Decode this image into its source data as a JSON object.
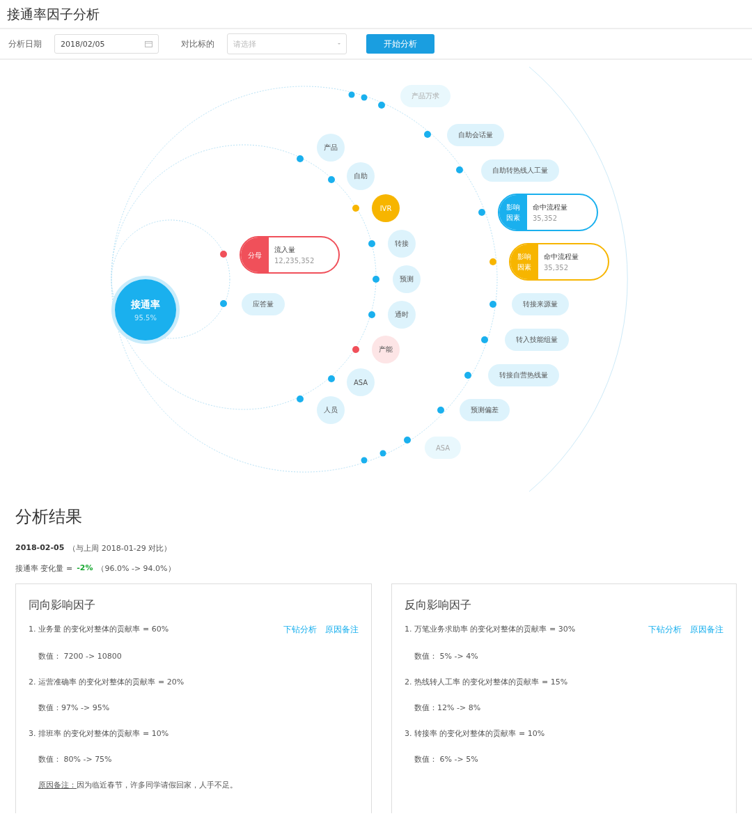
{
  "page": {
    "title": "接通率因子分析"
  },
  "toolbar": {
    "date_label": "分析日期",
    "date_value": "2018/02/05",
    "target_label": "对比标的",
    "target_placeholder": "请选择",
    "start_button": "开始分析"
  },
  "diagram": {
    "center": {
      "label": "接通率",
      "value": "95.5%"
    },
    "rings": [
      [
        {
          "kind": "factor",
          "color": "#f0505a",
          "tag": "分母",
          "label": "流入量",
          "value": "12,235,352"
        },
        {
          "kind": "label",
          "color": "#1ab0ee",
          "dimmed": false,
          "label": "应答量"
        }
      ],
      [
        {
          "kind": "bubble",
          "color": "#1ab0ee",
          "filled": false,
          "label": "产品"
        },
        {
          "kind": "bubble",
          "color": "#1ab0ee",
          "filled": false,
          "label": "自助"
        },
        {
          "kind": "bubble",
          "color": "#f7b500",
          "filled": true,
          "label": "IVR"
        },
        {
          "kind": "bubble",
          "color": "#1ab0ee",
          "filled": false,
          "label": "转接"
        },
        {
          "kind": "bubble",
          "color": "#1ab0ee",
          "filled": false,
          "label": "预测"
        },
        {
          "kind": "bubble",
          "color": "#1ab0ee",
          "filled": false,
          "label": "通时"
        },
        {
          "kind": "bubble",
          "color": "#f0505a",
          "filled": false,
          "label": "产能"
        },
        {
          "kind": "bubble",
          "color": "#1ab0ee",
          "filled": false,
          "label": "ASA"
        },
        {
          "kind": "bubble",
          "color": "#1ab0ee",
          "filled": false,
          "label": "人员"
        }
      ],
      [
        {
          "kind": "label",
          "color": "#1ab0ee",
          "dimmed": true,
          "label": "产品万求"
        },
        {
          "kind": "label",
          "color": "#1ab0ee",
          "dimmed": false,
          "label": "自助会话量"
        },
        {
          "kind": "label",
          "color": "#1ab0ee",
          "dimmed": false,
          "label": "自助转热线人工量"
        },
        {
          "kind": "factor",
          "color": "#1ab0ee",
          "tag": "影响因素",
          "label": "命中流程量",
          "value": "35,352"
        },
        {
          "kind": "factor",
          "color": "#f7b500",
          "tag": "影响因素",
          "label": "命中流程量",
          "value": "35,352"
        },
        {
          "kind": "label",
          "color": "#1ab0ee",
          "dimmed": false,
          "label": "转接来源量"
        },
        {
          "kind": "label",
          "color": "#1ab0ee",
          "dimmed": false,
          "label": "转入技能组量"
        },
        {
          "kind": "label",
          "color": "#1ab0ee",
          "dimmed": false,
          "label": "转接自营热线量"
        },
        {
          "kind": "label",
          "color": "#1ab0ee",
          "dimmed": false,
          "label": "预测偏差"
        },
        {
          "kind": "label",
          "color": "#1ab0ee",
          "dimmed": true,
          "label": "ASA"
        }
      ]
    ]
  },
  "result": {
    "title": "分析结果",
    "date": "2018-02-05",
    "compare": "（与上周 2018-01-29 对比）",
    "change_label": "接通率 变化量 =",
    "change_value": "-2%",
    "change_detail": "（96.0% -> 94.0%）",
    "panels": [
      {
        "title": "同向影响因子",
        "factors": [
          {
            "text": "1. 业务量 的变化对整体的贡献率 = 60%",
            "value": "数值：  7200 -> 10800",
            "links": [
              "下钻分析",
              "原因备注"
            ]
          },
          {
            "text": "2. 运营准确率 的变化对整体的贡献率 = 20%",
            "value": "数值：97% -> 95%"
          },
          {
            "text": "3. 排班率 的变化对整体的贡献率 = 10%",
            "value": "数值：  80% -> 75%"
          }
        ],
        "note": {
          "label": "原因备注：",
          "text": "因为临近春节，许多同学请假回家，人手不足。"
        }
      },
      {
        "title": "反向影响因子",
        "factors": [
          {
            "text": "1. 万笔业务求助率 的变化对整体的贡献率 = 30%",
            "value": "数值：  5% -> 4%",
            "links": [
              "下钻分析",
              "原因备注"
            ]
          },
          {
            "text": "2. 热线转人工率 的变化对整体的贡献率 = 15%",
            "value": "数值：12% -> 8%"
          },
          {
            "text": "3. 转接率 的变化对整体的贡献率 = 10%",
            "value": "数值：  6% -> 5%"
          }
        ]
      }
    ]
  }
}
